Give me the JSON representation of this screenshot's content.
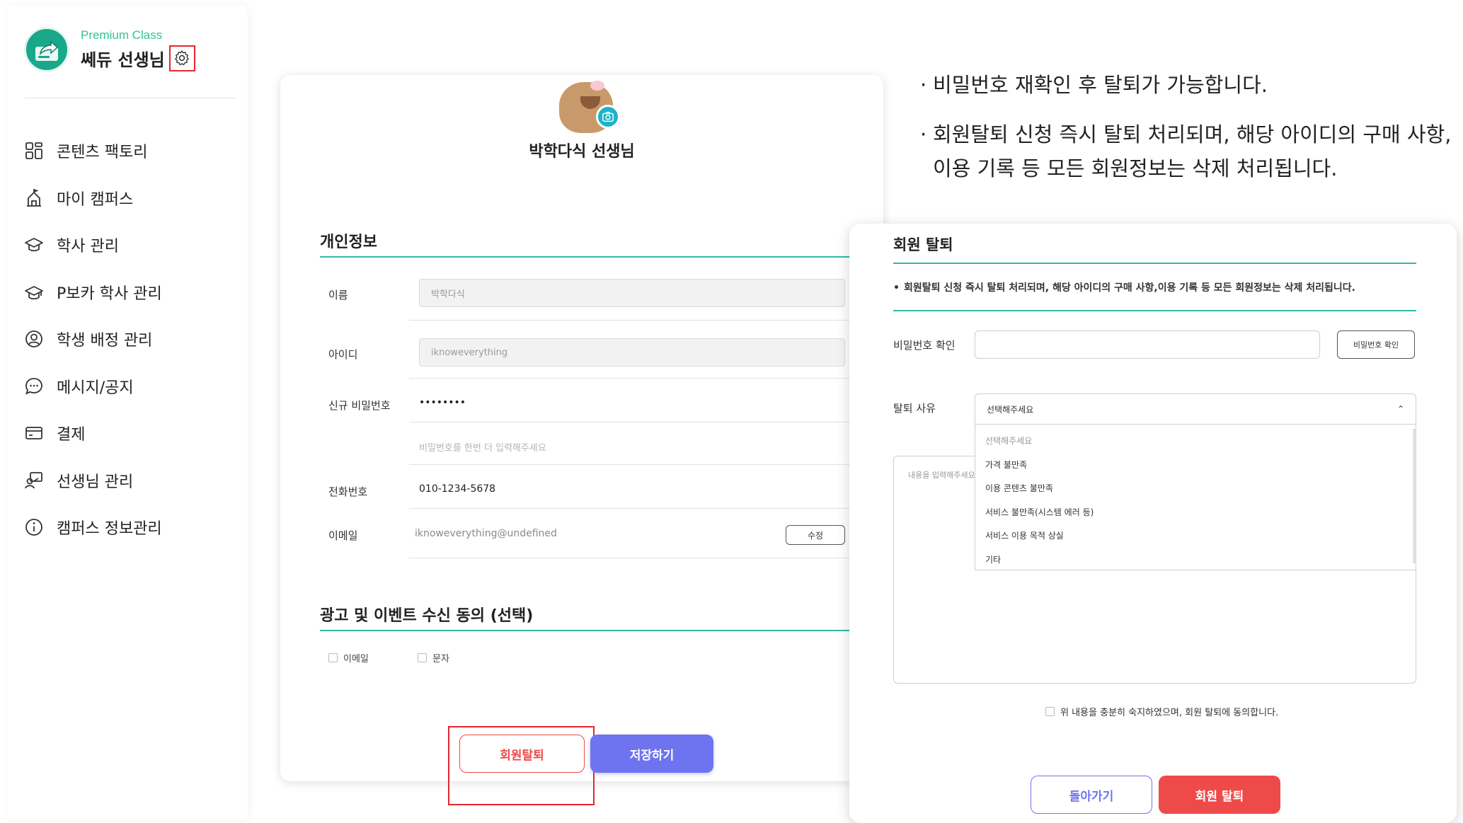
{
  "sidebar": {
    "premium_label": "Premium Class",
    "user_name": "쎄듀 선생님",
    "items": [
      {
        "label": "콘텐츠 팩토리",
        "icon": "grid-icon"
      },
      {
        "label": "마이 캠퍼스",
        "icon": "campus-icon"
      },
      {
        "label": "학사 관리",
        "icon": "graduation-cap-icon"
      },
      {
        "label": "P보카 학사 관리",
        "icon": "graduation-cap-icon"
      },
      {
        "label": "학생 배정 관리",
        "icon": "user-circle-icon"
      },
      {
        "label": "메시지/공지",
        "icon": "chat-bubble-icon"
      },
      {
        "label": "결제",
        "icon": "credit-card-icon"
      },
      {
        "label": "선생님 관리",
        "icon": "teacher-icon"
      },
      {
        "label": "캠퍼스 정보관리",
        "icon": "info-icon"
      }
    ]
  },
  "profile": {
    "name": "박학다식 선생님"
  },
  "personal_info": {
    "title": "개인정보",
    "name_label": "이름",
    "name_value": "박학다식",
    "id_label": "아이디",
    "id_value": "iknoweverything",
    "new_pw_label": "신규 비밀번호",
    "new_pw_value": "••••••••",
    "pw_confirm_placeholder": "비밀번호를 한번 더 입력해주세요",
    "phone_label": "전화번호",
    "phone_value": "010-1234-5678",
    "email_label": "이메일",
    "email_value": "iknoweverything@undefined",
    "edit_label": "수정"
  },
  "marketing": {
    "title": "광고 및 이벤트 수신 동의 (선택)",
    "email_label": "이메일",
    "sms_label": "문자"
  },
  "actions": {
    "withdraw_label": "회원탈퇴",
    "save_label": "저장하기"
  },
  "notes": [
    "비밀번호 재확인 후 탈퇴가 가능합니다.",
    "회원탈퇴 신청 즉시 탈퇴 처리되며, 해당 아이디의 구매 사항, 이용 기록 등 모든 회원정보는 삭제 처리됩니다."
  ],
  "modal": {
    "title": "회원 탈퇴",
    "notice": "회원탈퇴 신청 즉시 탈퇴 처리되며, 해당 아이디의 구매 사항,이용 기록 등 모든 회원정보는 삭제 처리됩니다.",
    "pw_label": "비밀번호 확인",
    "pw_button": "비밀번호 확인",
    "reason_label": "탈퇴 사유",
    "reason_selected": "선택해주세요",
    "reason_options": [
      "선택해주세요",
      "가격 불만족",
      "이용 콘텐츠 불만족",
      "서비스 불만족(시스템 에러 등)",
      "서비스 이용 목적 상실",
      "기타"
    ],
    "detail_placeholder": "내용을 입력해주세요",
    "agree_label": "위 내용을 충분히 숙지하였으며, 회원 탈퇴에 동의합니다.",
    "back_label": "돌아가기",
    "confirm_label": "회원 탈퇴"
  },
  "colors": {
    "accent_teal": "#30b8a8",
    "danger_red": "#ef4a4a",
    "primary_purple": "#6e74ef",
    "highlight_red": "#e5262f"
  }
}
